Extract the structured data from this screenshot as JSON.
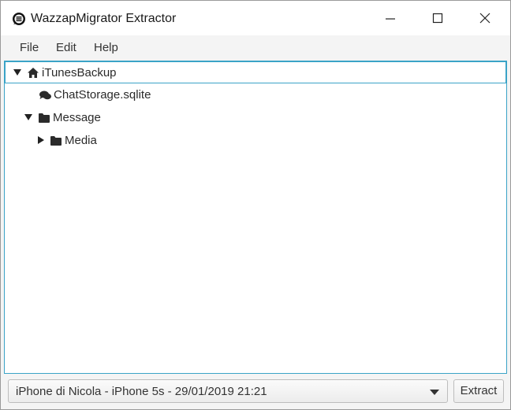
{
  "window": {
    "title": "WazzapMigrator Extractor",
    "controls": [
      "minimize-icon",
      "maximize-icon",
      "close-icon"
    ]
  },
  "menu": {
    "file": "File",
    "edit": "Edit",
    "help": "Help"
  },
  "tree": {
    "nodes": [
      {
        "label": "iTunesBackup",
        "icon": "home-icon",
        "expanded": true,
        "selected": true
      },
      {
        "label": "ChatStorage.sqlite",
        "icon": "chat-bubbles-icon",
        "leaf": true
      },
      {
        "label": "Message",
        "icon": "folder-icon",
        "expanded": true
      },
      {
        "label": "Media",
        "icon": "folder-icon",
        "expanded": false
      }
    ]
  },
  "bottom": {
    "device_selection": "iPhone di Nicola - iPhone 5s - 29/01/2019 21:21",
    "extract_label": "Extract"
  },
  "colors": {
    "accent": "#3aa3c7",
    "icon": "#2b2b2b"
  }
}
